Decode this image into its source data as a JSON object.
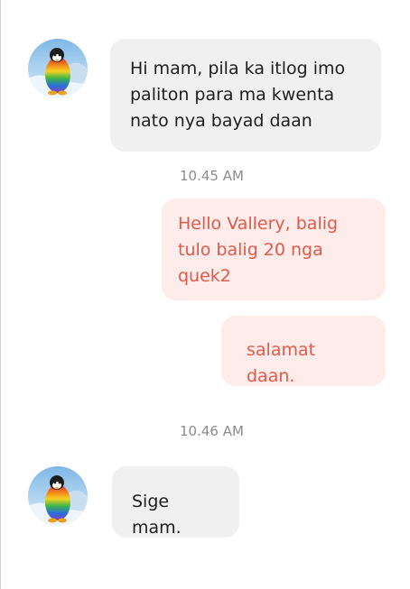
{
  "conversation": {
    "messages": [
      {
        "sender": "contact",
        "text": "Hi mam, pila ka itlog imo\npaliton para ma kwenta\nnato nya bayad daan"
      },
      {
        "type": "timestamp",
        "text": "10.45 AM"
      },
      {
        "sender": "me",
        "text": "Hello Vallery, balig\ntulo balig 20 nga\nquek2"
      },
      {
        "sender": "me",
        "text": "salamat daan."
      },
      {
        "type": "timestamp",
        "text": "10.46 AM"
      },
      {
        "sender": "contact",
        "text": "Sige mam."
      }
    ]
  },
  "avatar": {
    "icon": "rainbow-penguin-icon",
    "colors": [
      "#e0242a",
      "#f07b1c",
      "#f5d21f",
      "#3bb54a",
      "#2a6fd8",
      "#8a3ec9"
    ]
  },
  "colors": {
    "incoming_bubble": "#f0f0f0",
    "outgoing_bubble": "#fdecea",
    "outgoing_text": "#e1594a",
    "timestamp": "#8c8c8c"
  }
}
